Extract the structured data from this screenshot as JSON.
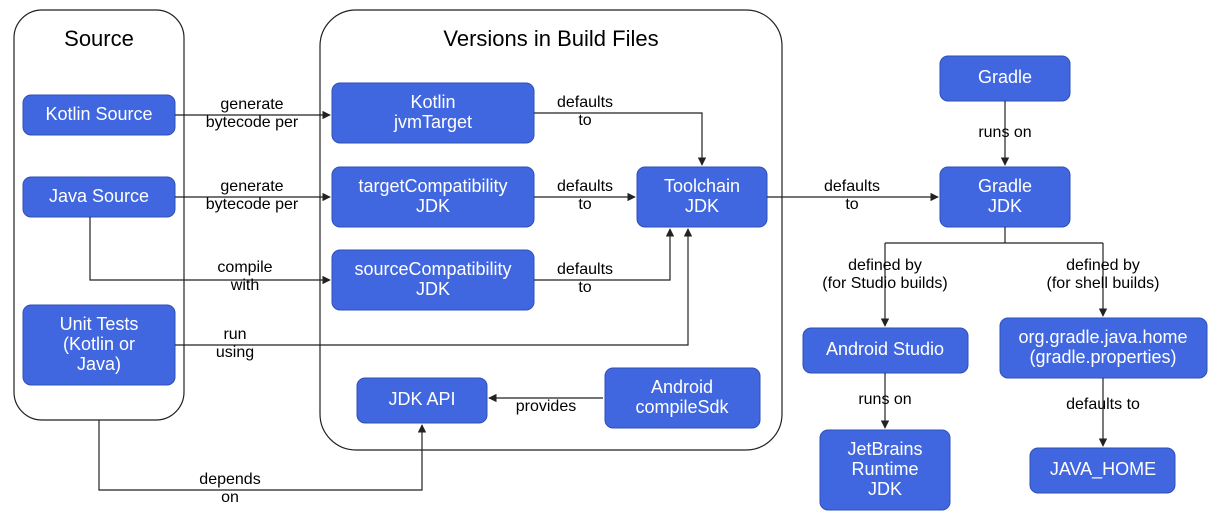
{
  "groups": {
    "source": {
      "title": "Source"
    },
    "versions": {
      "title": "Versions in Build Files"
    }
  },
  "nodes": {
    "kotlin_source": "Kotlin Source",
    "java_source": "Java Source",
    "unit_tests_l1": "Unit Tests",
    "unit_tests_l2": "(Kotlin or",
    "unit_tests_l3": "Java)",
    "kotlin_jvm_l1": "Kotlin",
    "kotlin_jvm_l2": "jvmTarget",
    "target_compat_l1": "targetCompatibility",
    "target_compat_l2": "JDK",
    "source_compat_l1": "sourceCompatibility",
    "source_compat_l2": "JDK",
    "jdk_api": "JDK API",
    "android_sdk_l1": "Android",
    "android_sdk_l2": "compileSdk",
    "toolchain_l1": "Toolchain",
    "toolchain_l2": "JDK",
    "gradle": "Gradle",
    "gradle_jdk_l1": "Gradle",
    "gradle_jdk_l2": "JDK",
    "android_studio": "Android Studio",
    "org_gradle_l1": "org.gradle.java.home",
    "org_gradle_l2": "(gradle.properties)",
    "jetbrains_l1": "JetBrains",
    "jetbrains_l2": "Runtime",
    "jetbrains_l3": "JDK",
    "java_home": "JAVA_HOME"
  },
  "edges": {
    "gen_bytecode_l1": "generate",
    "gen_bytecode_l2": "bytecode per",
    "compile_with_l1": "compile",
    "compile_with_l2": "with",
    "run_using_l1": "run",
    "run_using_l2": "using",
    "defaults_to_l1": "defaults",
    "defaults_to_l2": "to",
    "provides": "provides",
    "runs_on": "runs on",
    "defined_studio_l1": "defined by",
    "defined_studio_l2": "(for Studio builds)",
    "defined_shell_l1": "defined by",
    "defined_shell_l2": "(for shell builds)",
    "defaults_to_single": "defaults to",
    "depends_on_l1": "depends",
    "depends_on_l2": "on"
  }
}
